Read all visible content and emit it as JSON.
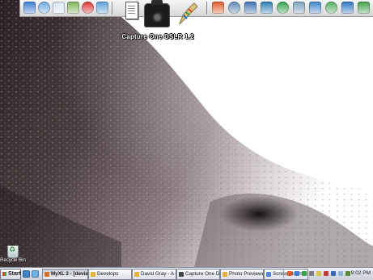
{
  "dock": {
    "left_icons": [
      {
        "name": "computer-icon",
        "color": "#3a7bd5"
      },
      {
        "name": "documents-icon",
        "color": "#6aa9e0"
      },
      {
        "name": "documents-icon-2",
        "color": "#d8e6f2"
      },
      {
        "name": "picture-icon",
        "color": "#7fb356"
      },
      {
        "name": "favorites-icon",
        "color": "#d9332c"
      },
      {
        "name": "folder-icon",
        "color": "#5a9fd8"
      }
    ],
    "right_icons": [
      {
        "name": "target-icon",
        "color": "#e0582a"
      },
      {
        "name": "monitor-icon",
        "color": "#5e88b8"
      },
      {
        "name": "network-icon",
        "color": "#3e6fb0"
      },
      {
        "name": "media-icon",
        "color": "#2c7db8"
      },
      {
        "name": "messenger-icon",
        "color": "#31a04a"
      },
      {
        "name": "disc-icon",
        "color": "#7aa0b8"
      },
      {
        "name": "browser-icon",
        "color": "#3f85c9"
      },
      {
        "name": "tools-icon",
        "color": "#4fae5a"
      },
      {
        "name": "arrow-icon",
        "color": "#2a72c2"
      },
      {
        "name": "terminal-icon",
        "color": "#3f9f48"
      }
    ]
  },
  "desktop": {
    "capture_label": "Capture One DSLR 1.2",
    "recycle_label": "Recycle Bin"
  },
  "taskbar": {
    "start_label": "Start",
    "buttons": [
      {
        "label": "MyXL 2 - [deviantART...",
        "active": true,
        "color": "#d66f2a"
      },
      {
        "label": "Develops",
        "active": false,
        "color": "#e4b23a"
      },
      {
        "label": "David Gray - A Cent...",
        "active": false,
        "color": "#e4b23a"
      },
      {
        "label": "Capture One DSLR...",
        "active": false,
        "color": "#444444"
      },
      {
        "label": "Photo Previewer",
        "active": false,
        "color": "#e4b23a"
      },
      {
        "label": "Screen doors don't...",
        "active": false,
        "color": "#4f8bd0"
      }
    ],
    "clock": "9:02 PM"
  },
  "colors": {
    "wallpaper_dark": "#1f1718",
    "wallpaper_mid": "#6e5f62",
    "wallpaper_light": "#ffffff"
  }
}
